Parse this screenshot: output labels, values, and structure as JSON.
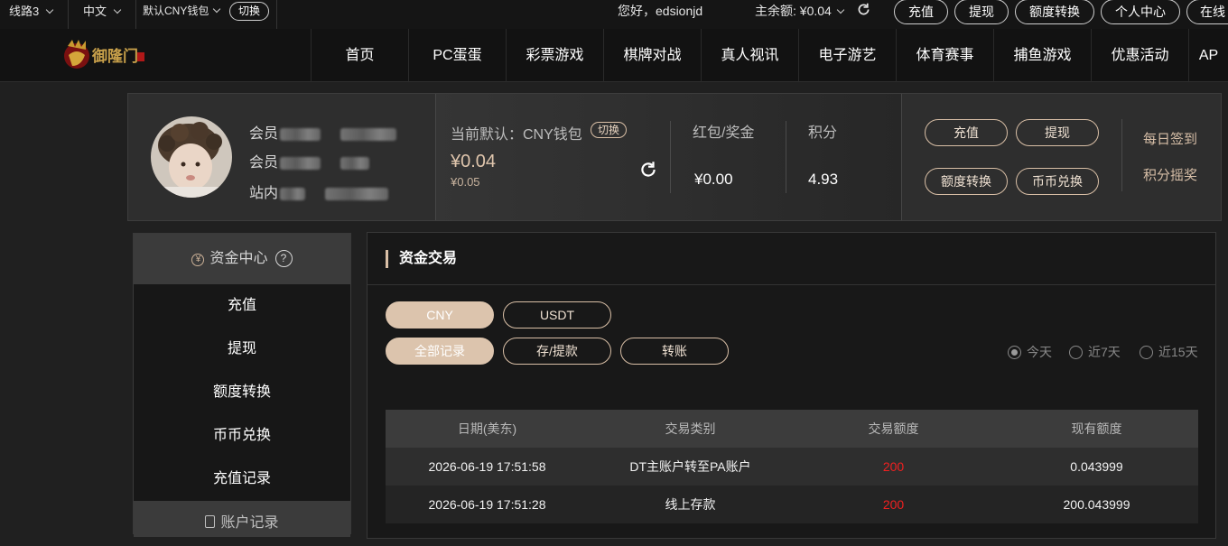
{
  "topbar": {
    "route": "线路3",
    "language": "中文",
    "wallet": "默认CNY钱包",
    "switch": "切换",
    "greeting": "您好，edsionjd",
    "balance": "主余额: ¥0.04",
    "buttons": [
      "充值",
      "提现",
      "额度转换",
      "个人中心",
      "在线"
    ]
  },
  "nav": {
    "items": [
      "首页",
      "PC蛋蛋",
      "彩票游戏",
      "棋牌对战",
      "真人视讯",
      "电子游艺",
      "体育赛事",
      "捕鱼游戏",
      "优惠活动",
      "AP"
    ]
  },
  "profile": {
    "rows": [
      "会员",
      "会员",
      "站内"
    ],
    "wallet_label": "当前默认：CNY钱包",
    "switch": "切换",
    "balance": "¥0.04",
    "balance_small": "¥0.05",
    "bonus_label": "红包/奖金",
    "bonus_value": "¥0.00",
    "points_label": "积分",
    "points_value": "4.93",
    "actions": [
      "充值",
      "提现",
      "额度转换",
      "币币兑换"
    ],
    "daily_sign": "每日签到",
    "points_lottery": "积分摇奖"
  },
  "sidebar": {
    "header": "资金中心",
    "items": [
      "充值",
      "提现",
      "额度转换",
      "币币兑换",
      "充值记录"
    ],
    "footer": "账户记录"
  },
  "main": {
    "title": "资金交易",
    "currency_tabs": [
      "CNY",
      "USDT"
    ],
    "record_tabs": [
      "全部记录",
      "存/提款",
      "转账"
    ],
    "ranges": [
      "今天",
      "近7天",
      "近15天"
    ],
    "table": {
      "headers": [
        "日期(美东)",
        "交易类别",
        "交易额度",
        "现有额度"
      ],
      "rows": [
        [
          "2026-06-19 17:51:58",
          "DT主账户转至PA账户",
          "200",
          "0.043999"
        ],
        [
          "2026-06-19 17:51:28",
          "线上存款",
          "200",
          "200.043999"
        ]
      ]
    }
  },
  "colors": {
    "accent": "#dcc4ad",
    "amount": "#f02020",
    "background": "#202020"
  }
}
